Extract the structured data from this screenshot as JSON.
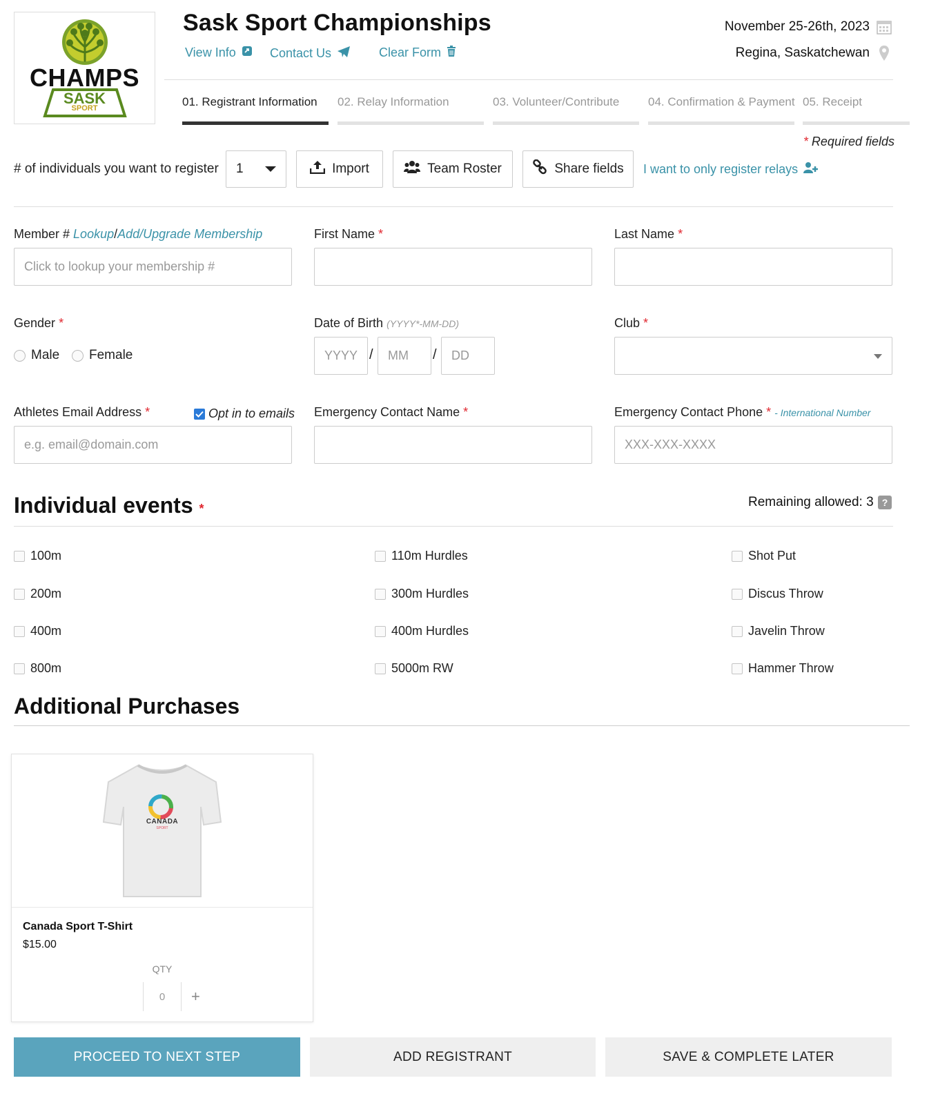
{
  "header": {
    "logo_text": "CHAMPS",
    "logo_sub": "SASK",
    "logo_sub2": "SPORT",
    "title": "Sask Sport Championships",
    "links": [
      "View Info",
      "Contact Us",
      "Clear Form"
    ],
    "date": "November 25-26th, 2023",
    "location": "Regina, Saskatchewan"
  },
  "steps": [
    {
      "label": "01. Registrant Information",
      "active": true
    },
    {
      "label": "02. Relay Information",
      "active": false
    },
    {
      "label": "03. Volunteer/Contribute",
      "active": false
    },
    {
      "label": "04. Confirmation & Payment",
      "active": false
    },
    {
      "label": "05. Receipt",
      "active": false
    }
  ],
  "required_note": "Required fields",
  "register": {
    "label": "# of individuals you want to register",
    "count": "1",
    "import": "Import",
    "team_roster": "Team Roster",
    "share_fields": "Share fields",
    "relays_link": "I want to only register relays"
  },
  "form": {
    "member_label": "Member #",
    "lookup": "Lookup",
    "slash": "/",
    "add_upgrade": "Add/Upgrade Membership",
    "member_placeholder": "Click to lookup your membership #",
    "first_name": "First Name",
    "last_name": "Last Name",
    "gender": "Gender",
    "male": "Male",
    "female": "Female",
    "dob": "Date of Birth",
    "dob_hint": "(YYYY*-MM-DD)",
    "yyyy": "YYYY",
    "mm": "MM",
    "dd": "DD",
    "club": "Club",
    "email_label": "Athletes Email Address",
    "opt_in": "Opt in to emails",
    "email_placeholder": "e.g. email@domain.com",
    "emergency_name": "Emergency Contact Name",
    "emergency_phone": "Emergency Contact Phone",
    "intl": "- International Number",
    "phone_placeholder": "XXX-XXX-XXXX"
  },
  "events": {
    "title": "Individual events",
    "remaining": "Remaining allowed: 3",
    "col1": [
      "100m",
      "200m",
      "400m",
      "800m"
    ],
    "col2": [
      "110m Hurdles",
      "300m Hurdles",
      "400m Hurdles",
      "5000m RW"
    ],
    "col3": [
      "Shot Put",
      "Discus Throw",
      "Javelin Throw",
      "Hammer Throw"
    ]
  },
  "purchases": {
    "title": "Additional Purchases",
    "item_name": "Canada Sport T-Shirt",
    "item_price": "$15.00",
    "shirt_text": "CANADA",
    "shirt_sub": "SPORT",
    "qty_label": "QTY",
    "qty": "0",
    "plus": "+"
  },
  "actions": {
    "proceed": "PROCEED TO NEXT STEP",
    "add": "ADD REGISTRANT",
    "save": "SAVE & COMPLETE LATER"
  },
  "colors": {
    "accent": "#3a92a8",
    "primary_button": "#5aa4bd",
    "required": "#e0272f",
    "logo_green": "#5a8a1f",
    "logo_yellow": "#c5c21e"
  }
}
